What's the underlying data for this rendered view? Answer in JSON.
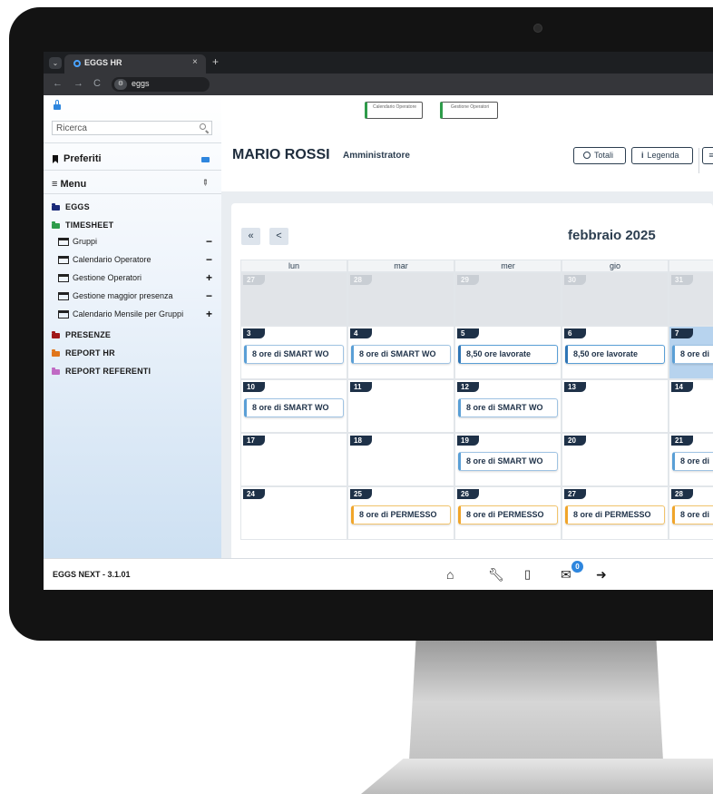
{
  "browser": {
    "tab_title": "EGGS HR",
    "tab_close": "×",
    "new_tab": "+",
    "url": "eggs",
    "nav_back": "←",
    "nav_forward": "→",
    "nav_reload": "C"
  },
  "toolbar": {
    "btn1": "Calendario Operatore",
    "btn2": "Gestione Operatori"
  },
  "sidebar": {
    "search_placeholder": "Ricerca",
    "preferiti": "Preferiti",
    "menu": "≡ Menu",
    "categories": [
      {
        "label": "EGGS",
        "color": "#1a2a7a"
      },
      {
        "label": "TIMESHEET",
        "color": "#2e9c4a"
      },
      {
        "label": "PRESENZE",
        "color": "#a01818"
      },
      {
        "label": "REPORT HR",
        "color": "#e0761b"
      },
      {
        "label": "REPORT REFERENTI",
        "color": "#c06ac4"
      }
    ],
    "timesheet_items": [
      {
        "label": "Gruppi",
        "mark": "−"
      },
      {
        "label": "Calendario Operatore",
        "mark": "−"
      },
      {
        "label": "Gestione Operatori",
        "mark": "+"
      },
      {
        "label": "Gestione maggior presenza",
        "mark": "−"
      },
      {
        "label": "Calendario Mensile per Gruppi",
        "mark": "+"
      }
    ]
  },
  "header": {
    "user_name": "MARIO ROSSI",
    "user_role": "Amministratore",
    "totali": "Totali",
    "legenda": "Legenda",
    "partial_btn": "≡"
  },
  "calendar": {
    "month": "febbraio 2025",
    "nav_first": "«",
    "nav_prev": "<",
    "days_of_week": [
      "lun",
      "mar",
      "mer",
      "gio",
      ""
    ],
    "weeks": [
      [
        {
          "day": "27",
          "other": true,
          "event": null
        },
        {
          "day": "28",
          "other": true,
          "event": null
        },
        {
          "day": "29",
          "other": true,
          "event": null
        },
        {
          "day": "30",
          "other": true,
          "event": null
        },
        {
          "day": "31",
          "other": true,
          "event": null
        }
      ],
      [
        {
          "day": "3",
          "event": "8 ore di SMART WO",
          "type": "smart"
        },
        {
          "day": "4",
          "event": "8 ore di SMART WO",
          "type": "smart"
        },
        {
          "day": "5",
          "event": "8,50 ore lavorate",
          "type": "work"
        },
        {
          "day": "6",
          "event": "8,50 ore lavorate",
          "type": "work"
        },
        {
          "day": "7",
          "event": "8 ore di",
          "type": "smart",
          "selected": true
        }
      ],
      [
        {
          "day": "10",
          "event": "8 ore di SMART WO",
          "type": "smart"
        },
        {
          "day": "11",
          "event": null
        },
        {
          "day": "12",
          "event": "8 ore di SMART WO",
          "type": "smart"
        },
        {
          "day": "13",
          "event": null
        },
        {
          "day": "14",
          "event": null
        }
      ],
      [
        {
          "day": "17",
          "event": null
        },
        {
          "day": "18",
          "event": null
        },
        {
          "day": "19",
          "event": "8 ore di SMART WO",
          "type": "smart"
        },
        {
          "day": "20",
          "event": null
        },
        {
          "day": "21",
          "event": "8 ore di",
          "type": "smart"
        }
      ],
      [
        {
          "day": "24",
          "event": null
        },
        {
          "day": "25",
          "event": "8 ore di PERMESSO",
          "type": "permesso"
        },
        {
          "day": "26",
          "event": "8 ore di PERMESSO",
          "type": "permesso"
        },
        {
          "day": "27",
          "event": "8 ore di PERMESSO",
          "type": "permesso"
        },
        {
          "day": "28",
          "event": "8 ore di",
          "type": "permesso"
        }
      ]
    ]
  },
  "footer": {
    "version": "EGGS NEXT - 3.1.01",
    "mail_badge": "0",
    "icons": [
      "home-icon",
      "wrench-icon",
      "tablet-icon",
      "mail-icon",
      "logout-icon"
    ]
  }
}
